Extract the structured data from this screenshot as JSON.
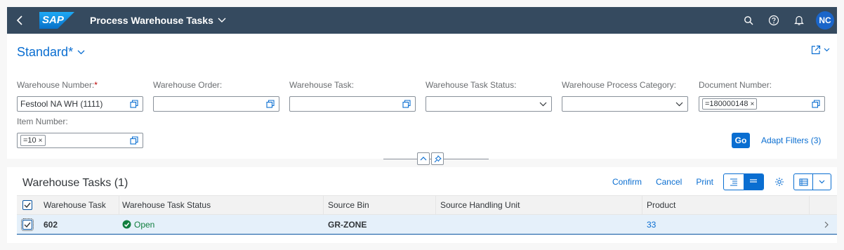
{
  "shell": {
    "logo_text": "SAP",
    "title": "Process Warehouse Tasks",
    "avatar_initials": "NC"
  },
  "variant": {
    "name": "Standard",
    "modified_mark": "*"
  },
  "filters": [
    {
      "label": "Warehouse Number:",
      "required": "*",
      "value": "Festool NA WH (1111)",
      "control": "value-help"
    },
    {
      "label": "Warehouse Order:",
      "value": "",
      "control": "value-help"
    },
    {
      "label": "Warehouse Task:",
      "value": "",
      "control": "value-help"
    },
    {
      "label": "Warehouse Task Status:",
      "value": "",
      "control": "dropdown"
    },
    {
      "label": "Warehouse Process Category:",
      "value": "",
      "control": "dropdown"
    },
    {
      "label": "Document Number:",
      "token": "=180000148",
      "control": "value-help"
    },
    {
      "label": "Item Number:",
      "token": "=10",
      "control": "value-help"
    }
  ],
  "actions": {
    "go_label": "Go",
    "adapt_label": "Adapt Filters (3)"
  },
  "table": {
    "title": "Warehouse Tasks (1)",
    "toolbar": {
      "confirm": "Confirm",
      "cancel": "Cancel",
      "print": "Print"
    },
    "columns": [
      "Warehouse Task",
      "Warehouse Task Status",
      "Source Bin",
      "Source Handling Unit",
      "Product"
    ],
    "rows": [
      {
        "task": "602",
        "status": "Open",
        "source_bin": "GR-ZONE",
        "source_hu": "",
        "product": "33"
      }
    ]
  },
  "colors": {
    "shell": "#354a5f",
    "accent": "#0a6ed1",
    "success": "#107e3e",
    "required": "#bb0000"
  }
}
